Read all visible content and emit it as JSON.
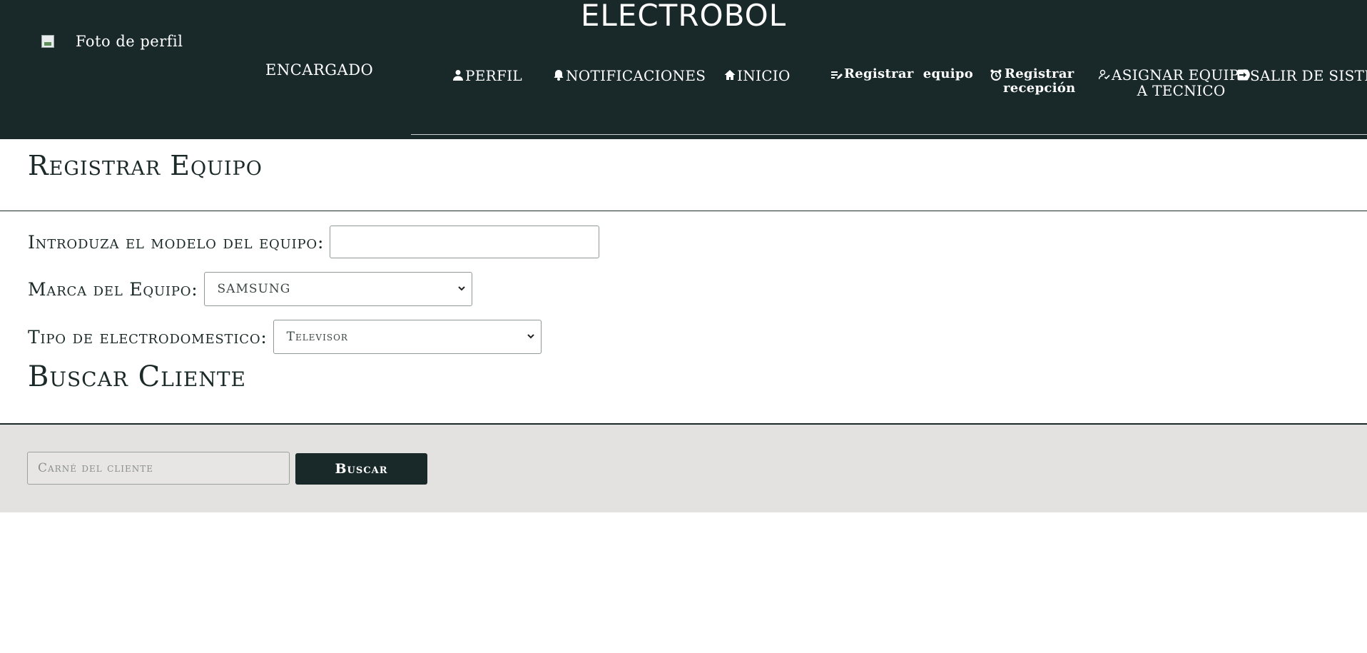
{
  "header": {
    "brand": "ELECTROBOL",
    "profile_photo_alt": "Foto de perfil",
    "role": "Encargado",
    "nav": {
      "perfil": "PERFIL",
      "notificaciones": "NOTIFICACIONES",
      "inicio": "INICIO",
      "registrar_equipo": "Registrar  equipo",
      "registrar_recepcion_1": "Registrar",
      "registrar_recepcion_2": "recepción",
      "asignar_1": "ASIGNAR EQUIPO",
      "asignar_2": "A TECNICO",
      "salir": "SALIR DE SISTEMA"
    }
  },
  "main": {
    "page_title": "Registrar Equipo",
    "model_label": "Introduza el modelo del equipo:",
    "model_value": "",
    "brand_label": "Marca del Equipo:",
    "brand_selected": "SAMSUNG",
    "type_label": "Tipo de electrodomestico:",
    "type_selected": "Televisor",
    "search_title": "Buscar Cliente"
  },
  "search": {
    "placeholder": "Carné del cliente",
    "button": "Buscar"
  }
}
